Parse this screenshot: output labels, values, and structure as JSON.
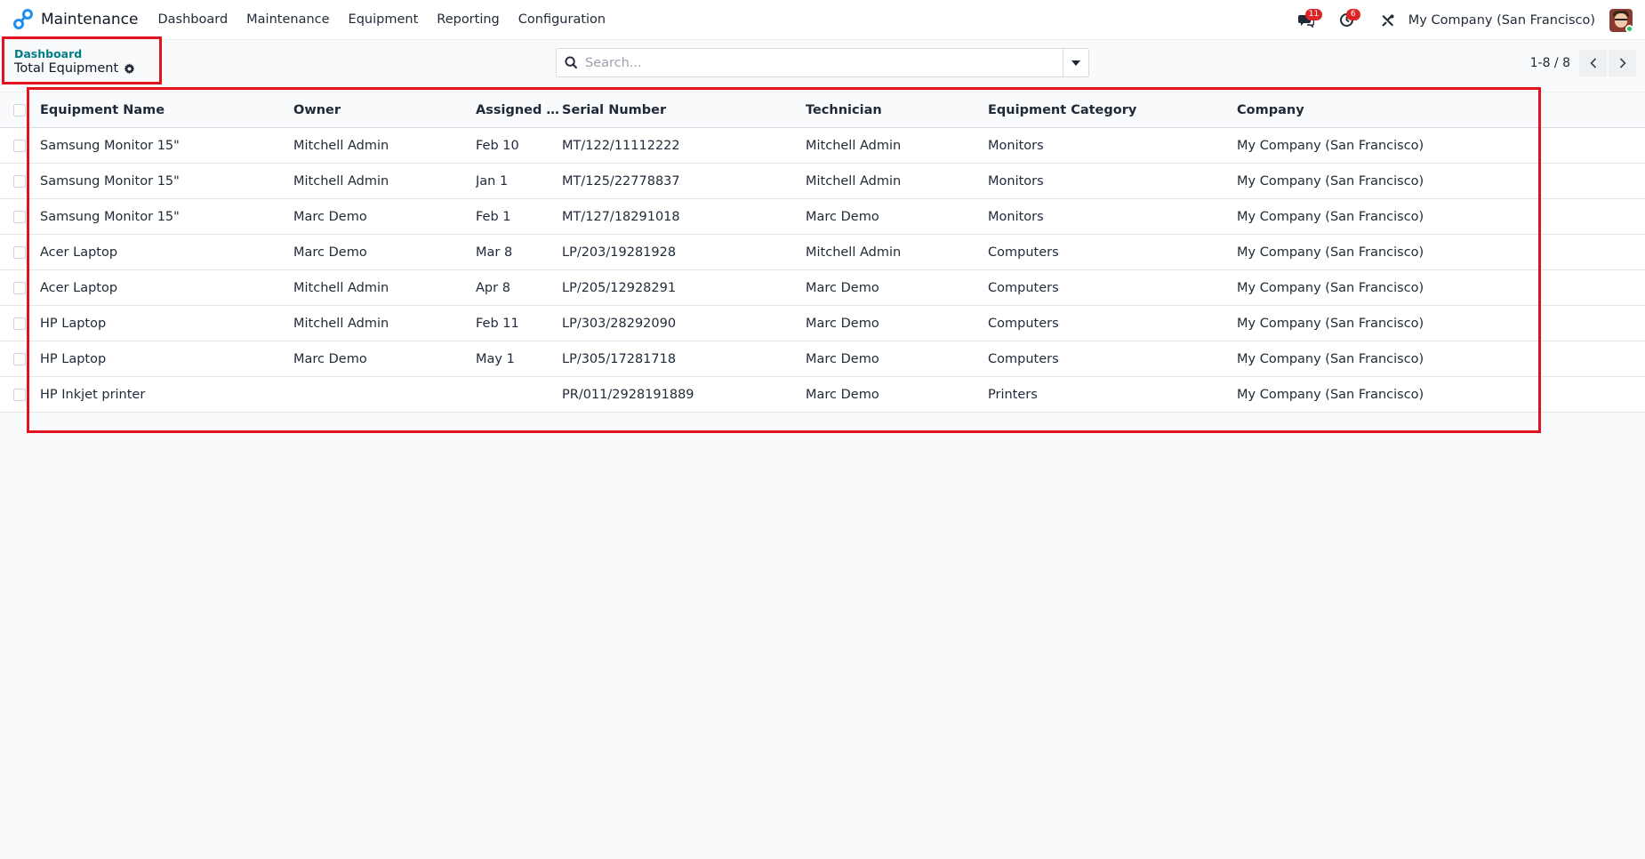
{
  "navbar": {
    "app_name": "Maintenance",
    "menu": [
      "Dashboard",
      "Maintenance",
      "Equipment",
      "Reporting",
      "Configuration"
    ],
    "messages_badge": "11",
    "activities_badge": "6",
    "company": "My Company (San Francisco)"
  },
  "breadcrumb": {
    "parent": "Dashboard",
    "current": "Total Equipment"
  },
  "search": {
    "placeholder": "Search...",
    "value": ""
  },
  "pager": {
    "value": "1-8 / 8"
  },
  "table": {
    "columns": [
      "Equipment Name",
      "Owner",
      "Assigned D...",
      "Serial Number",
      "Technician",
      "Equipment Category",
      "Company"
    ],
    "rows": [
      [
        "Samsung Monitor 15\"",
        "Mitchell Admin",
        "Feb 10",
        "MT/122/11112222",
        "Mitchell Admin",
        "Monitors",
        "My Company (San Francisco)"
      ],
      [
        "Samsung Monitor 15\"",
        "Mitchell Admin",
        "Jan 1",
        "MT/125/22778837",
        "Mitchell Admin",
        "Monitors",
        "My Company (San Francisco)"
      ],
      [
        "Samsung Monitor 15\"",
        "Marc Demo",
        "Feb 1",
        "MT/127/18291018",
        "Marc Demo",
        "Monitors",
        "My Company (San Francisco)"
      ],
      [
        "Acer Laptop",
        "Marc Demo",
        "Mar 8",
        "LP/203/19281928",
        "Mitchell Admin",
        "Computers",
        "My Company (San Francisco)"
      ],
      [
        "Acer Laptop",
        "Mitchell Admin",
        "Apr 8",
        "LP/205/12928291",
        "Marc Demo",
        "Computers",
        "My Company (San Francisco)"
      ],
      [
        "HP Laptop",
        "Mitchell Admin",
        "Feb 11",
        "LP/303/28292090",
        "Marc Demo",
        "Computers",
        "My Company (San Francisco)"
      ],
      [
        "HP Laptop",
        "Marc Demo",
        "May 1",
        "LP/305/17281718",
        "Marc Demo",
        "Computers",
        "My Company (San Francisco)"
      ],
      [
        "HP Inkjet printer",
        "",
        "",
        "PR/011/2928191889",
        "Marc Demo",
        "Printers",
        "My Company (San Francisco)"
      ]
    ]
  },
  "colors": {
    "accent": "#017e84",
    "badge": "#dc2626",
    "highlight": "#e0131f"
  }
}
